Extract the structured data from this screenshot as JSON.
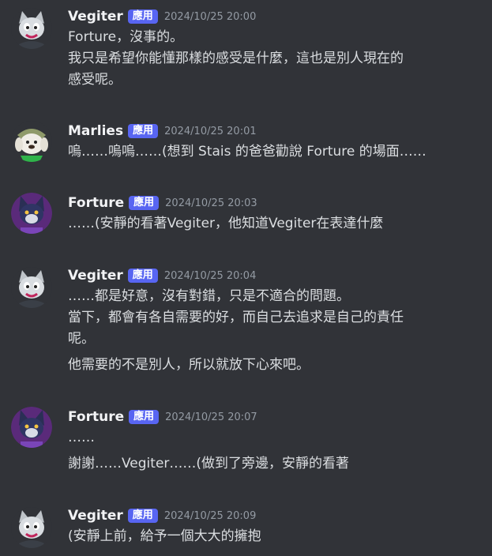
{
  "messages": [
    {
      "author": "Vegiter",
      "badge": "應用",
      "time": "2024/10/25 20:00",
      "avatar": "cat-avatar-icon",
      "lines": [
        "Forture，沒事的。",
        "我只是希望你能懂那樣的感受是什麼，這也是別人現在的",
        "感受呢。"
      ]
    },
    {
      "author": "Marlies",
      "badge": "應用",
      "time": "2024/10/25 20:01",
      "avatar": "dog-avatar-icon",
      "lines": [
        "嗚……嗚嗚……(想到 Stais 的爸爸勸說 Forture 的場面……"
      ]
    },
    {
      "author": "Forture",
      "badge": "應用",
      "time": "2024/10/25 20:03",
      "avatar": "wolf-avatar-icon",
      "lines": [
        "……(安靜的看著Vegiter，他知道Vegiter在表達什麼"
      ]
    },
    {
      "author": "Vegiter",
      "badge": "應用",
      "time": "2024/10/25 20:04",
      "avatar": "cat-avatar-icon",
      "lines": [
        "……都是好意，沒有對錯，只是不適合的問題。",
        "當下，都會有各自需要的好，而自己去追求是自己的責任",
        "呢。"
      ],
      "extra": "他需要的不是別人，所以就放下心來吧。"
    },
    {
      "author": "Forture",
      "badge": "應用",
      "time": "2024/10/25 20:07",
      "avatar": "wolf-avatar-icon",
      "lines": [
        "……"
      ],
      "extra": "謝謝……Vegiter……(做到了旁邊，安靜的看著"
    },
    {
      "author": "Vegiter",
      "badge": "應用",
      "time": "2024/10/25 20:09",
      "avatar": "cat-avatar-icon",
      "lines": [
        "(安靜上前，給予一個大大的擁抱"
      ]
    }
  ]
}
